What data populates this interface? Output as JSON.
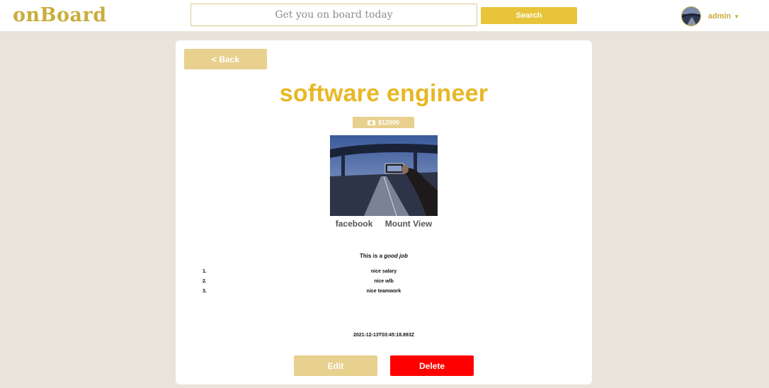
{
  "app": {
    "logo_text": "onBoard"
  },
  "search": {
    "placeholder": "Get you on board today",
    "value": "",
    "button_label": "Search"
  },
  "user": {
    "name": "admin",
    "menu_icon": "chevron-down-icon"
  },
  "job": {
    "back_label": "< Back",
    "title": "software engineer",
    "salary": "$12000",
    "salary_icon": "money-icon",
    "company": "facebook",
    "location": "Mount View",
    "description_prefix": "This is a ",
    "description_emphasis": "good job",
    "perks": [
      {
        "num": "1.",
        "text": "nice salary"
      },
      {
        "num": "2.",
        "text": "nice wlb"
      },
      {
        "num": "3.",
        "text": "nice teamwork"
      }
    ],
    "timestamp": "2021-12-13T03:45:18.893Z",
    "edit_label": "Edit",
    "delete_label": "Delete"
  },
  "colors": {
    "brand_gold": "#c9ad3c",
    "title_gold": "#e8b725",
    "search_button": "#e8c43a",
    "muted_gold": "#e8d08e",
    "danger": "#ff0000",
    "page_background": "#e8e4da"
  }
}
